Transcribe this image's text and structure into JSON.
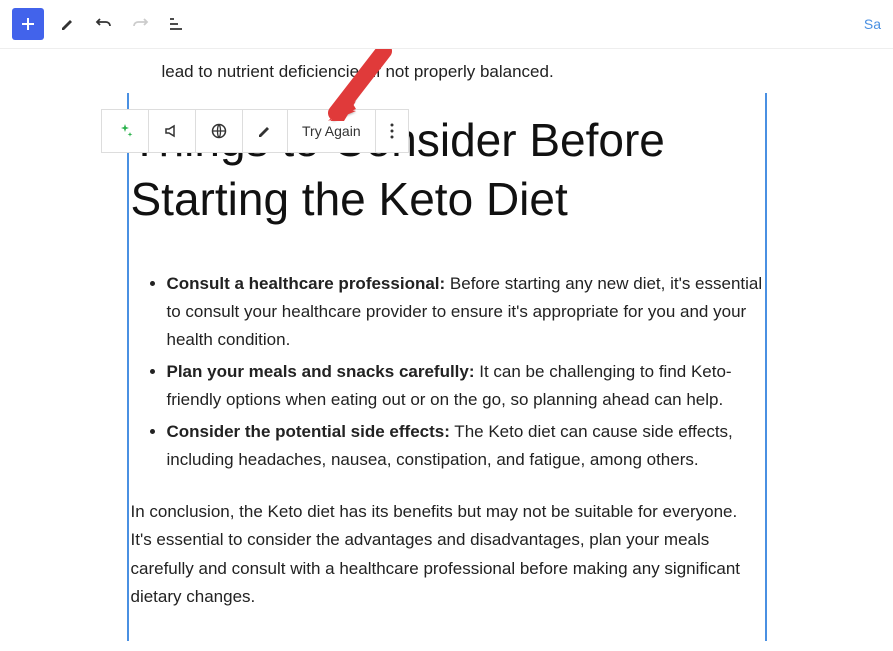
{
  "toolbar": {
    "save": "Sa"
  },
  "floating": {
    "try_again": "Try Again"
  },
  "partial_line": "lead to nutrient deficiencies if not properly balanced.",
  "heading": "Things to Consider Before Starting the Keto Diet",
  "bullets": [
    {
      "lead": "Consult a healthcare professional:",
      "rest": " Before starting any new diet, it's essential to consult your healthcare provider to ensure it's appropriate for you and your health condition."
    },
    {
      "lead": "Plan your meals and snacks carefully:",
      "rest": " It can be challenging to find Keto-friendly options when eating out or on the go, so planning ahead can help."
    },
    {
      "lead": "Consider the potential side effects:",
      "rest": " The Keto diet can cause side effects, including headaches, nausea, constipation, and fatigue, among others."
    }
  ],
  "conclusion": "In conclusion, the Keto diet has its benefits but may not be suitable for everyone. It's essential to consider the advantages and disadvantages, plan your meals carefully and consult with a healthcare professional before making any significant dietary changes."
}
